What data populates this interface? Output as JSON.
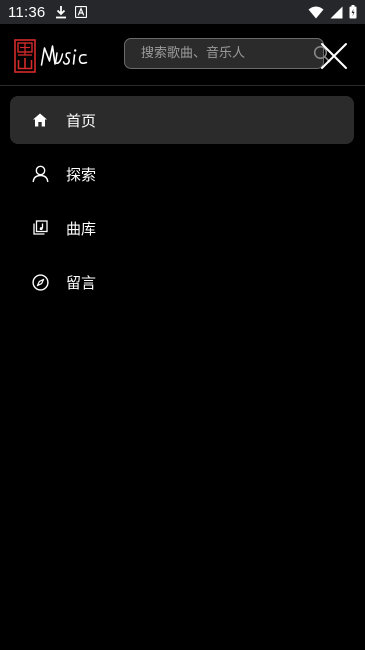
{
  "status_bar": {
    "time": "11:36",
    "icons": [
      "download-icon",
      "app-a-icon",
      "wifi-icon",
      "signal-icon",
      "battery-icon"
    ]
  },
  "header": {
    "logo_text": "Music",
    "logo_seal_text": "黑山",
    "search_placeholder": "搜索歌曲、音乐人",
    "accent_color": "#d42a2a"
  },
  "nav": {
    "items": [
      {
        "label": "首页",
        "icon": "home-icon",
        "active": true
      },
      {
        "label": "探索",
        "icon": "person-icon",
        "active": false
      },
      {
        "label": "曲库",
        "icon": "library-icon",
        "active": false
      },
      {
        "label": "留言",
        "icon": "compass-icon",
        "active": false
      }
    ]
  }
}
